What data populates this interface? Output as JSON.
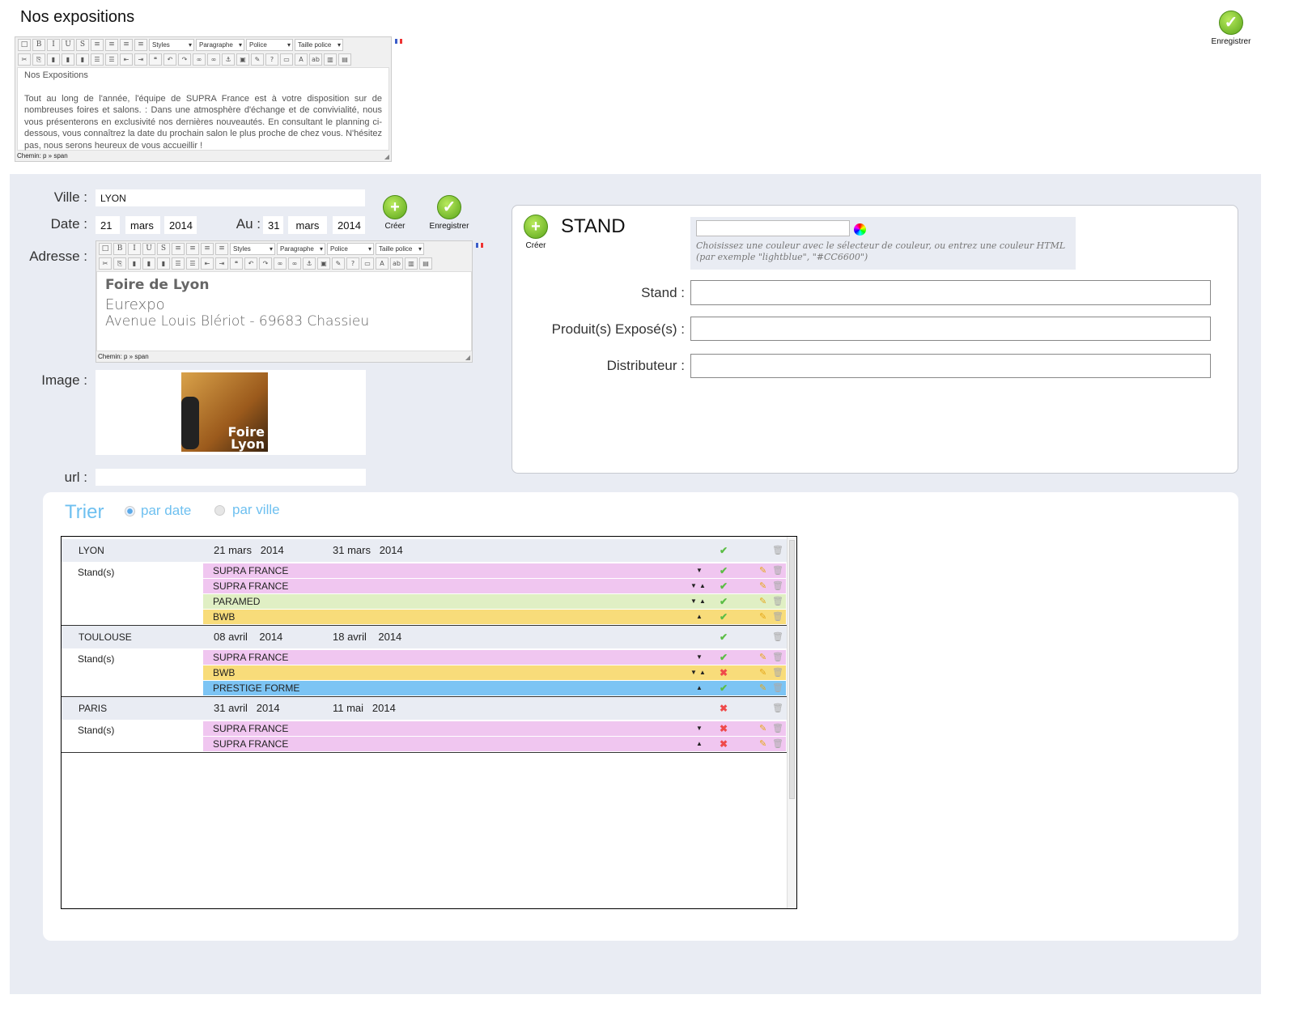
{
  "page_title": "Nos expositions",
  "top_save": {
    "label": "Enregistrer",
    "icon": "check-circle-icon"
  },
  "toolbar": {
    "row1_buttons": [
      "new-document",
      "bold",
      "italic",
      "underline",
      "strikethrough",
      "align-left",
      "align-center",
      "align-right",
      "justify"
    ],
    "row1_glyphs": [
      "□",
      "B",
      "I",
      "U",
      "S",
      "≡",
      "≡",
      "≡",
      "≡"
    ],
    "selects": [
      "Styles",
      "Paragraphe",
      "Police",
      "Taille police"
    ],
    "row2_buttons": [
      "cut",
      "copy",
      "paste",
      "paste-text",
      "paste-word",
      "bullet-list",
      "numbered-list",
      "outdent",
      "indent",
      "blockquote",
      "undo",
      "redo",
      "link",
      "unlink",
      "anchor",
      "image",
      "cleanup",
      "help",
      "html",
      "text-color",
      "highlight-color",
      "media",
      "table"
    ],
    "row2_glyphs": [
      "✂",
      "⎘",
      "▮",
      "▮",
      "▮",
      "☰",
      "☰",
      "⇤",
      "⇥",
      "❝",
      "↶",
      "↷",
      "∞",
      "∞",
      "⚓",
      "▣",
      "✎",
      "?",
      "▭",
      "A",
      "ab",
      "▥",
      "▤"
    ]
  },
  "intro_editor": {
    "heading": "Nos Expositions",
    "body": "Tout au long de l'année, l'équipe de SUPRA France est à votre disposition sur de nombreuses foires et salons. : Dans une atmosphère d'échange et de convivialité, nous vous présenterons en exclusivité nos dernières nouveautés. En consultant le planning ci-dessous, vous connaîtrez la date du prochain salon le plus proche de chez vous. N'hésitez pas, nous serons heureux de vous accueillir !",
    "status": "Chemin: p » span"
  },
  "form": {
    "ville_label": "Ville :",
    "ville_value": "LYON",
    "date_label": "Date :",
    "date_day": "21",
    "date_month": "mars",
    "date_year": "2014",
    "au_label": "Au :",
    "au_day": "31",
    "au_month": "mars",
    "au_year": "2014",
    "create_label": "Créer",
    "save_label": "Enregistrer",
    "adresse_label": "Adresse :",
    "adresse_title": "Foire de Lyon",
    "adresse_line1": "Eurexpo",
    "adresse_line2": "Avenue Louis Blériot - 69683 Chassieu",
    "adresse_status": "Chemin: p » span",
    "image_label": "Image :",
    "image_logo_text": "Foire Lyon",
    "url_label": "url :",
    "url_value": ""
  },
  "stand_panel": {
    "create_label": "Créer",
    "title": "STAND",
    "color_value": "",
    "color_help": "Choisissez une couleur avec le sélecteur de couleur, ou entrez une couleur HTML (par exemple \"lightblue\", \"#CC6600\")",
    "stand_label": "Stand :",
    "produits_label": "Produit(s) Exposé(s) :",
    "distributeur_label": "Distributeur :"
  },
  "sort": {
    "title": "Trier",
    "options": [
      {
        "label": "par date",
        "selected": true
      },
      {
        "label": "par ville",
        "selected": false
      }
    ]
  },
  "colors": {
    "pink": "#f0c6f0",
    "green": "#e0efc4",
    "yellow": "#f8dc7a",
    "blue": "#7cc4f4",
    "accent": "#6ec0f0"
  },
  "stands_label": "Stand(s)",
  "events": [
    {
      "city": "LYON",
      "start": "21 mars   2014",
      "end": "31 mars   2014",
      "valid": true,
      "stands": [
        {
          "name": "SUPRA FRANCE",
          "color": "pink",
          "down": true,
          "up": false,
          "valid": true
        },
        {
          "name": "SUPRA FRANCE",
          "color": "pink",
          "down": true,
          "up": true,
          "valid": true
        },
        {
          "name": "PARAMED",
          "color": "green",
          "down": true,
          "up": true,
          "valid": true
        },
        {
          "name": "BWB",
          "color": "yellow",
          "down": false,
          "up": true,
          "valid": true
        }
      ]
    },
    {
      "city": "TOULOUSE",
      "start": "08 avril    2014",
      "end": "18 avril    2014",
      "valid": true,
      "stands": [
        {
          "name": "SUPRA FRANCE",
          "color": "pink",
          "down": true,
          "up": false,
          "valid": true
        },
        {
          "name": "BWB",
          "color": "yellow",
          "down": true,
          "up": true,
          "valid": false
        },
        {
          "name": "PRESTIGE FORME",
          "color": "blue",
          "down": false,
          "up": true,
          "valid": true
        }
      ]
    },
    {
      "city": "PARIS",
      "start": "31 avril   2014",
      "end": "11 mai   2014",
      "valid": false,
      "stands": [
        {
          "name": "SUPRA FRANCE",
          "color": "pink",
          "down": true,
          "up": false,
          "valid": false
        },
        {
          "name": "SUPRA FRANCE",
          "color": "pink",
          "down": false,
          "up": true,
          "valid": false
        }
      ]
    }
  ]
}
